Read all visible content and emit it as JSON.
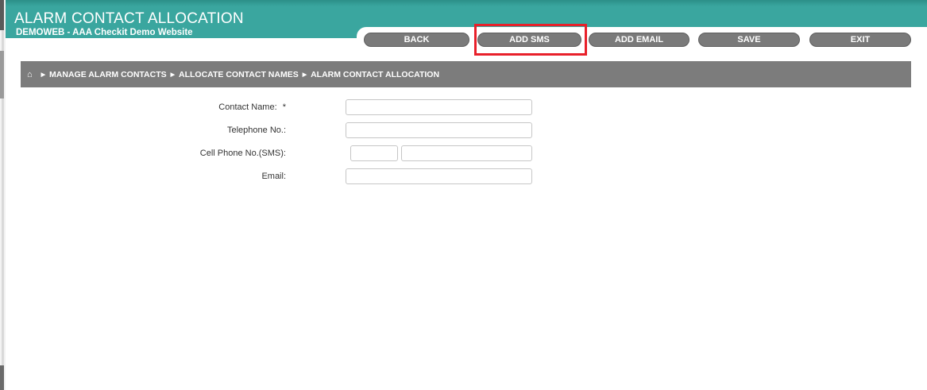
{
  "header": {
    "title": "ALARM CONTACT ALLOCATION",
    "subtitle": "DEMOWEB - AAA Checkit Demo Website"
  },
  "toolbar": {
    "back": "BACK",
    "add_sms": "ADD SMS",
    "add_email": "ADD EMAIL",
    "save": "SAVE",
    "exit": "EXIT"
  },
  "breadcrumb": {
    "home_icon": "home-icon",
    "items": [
      "MANAGE ALARM CONTACTS",
      "ALLOCATE CONTACT NAMES",
      "ALARM CONTACT ALLOCATION"
    ]
  },
  "form": {
    "contact_name_label": "Contact Name:",
    "required_mark": "*",
    "telephone_label": "Telephone No.:",
    "cell_label": "Cell Phone No.(SMS):",
    "email_label": "Email:",
    "contact_name_value": "",
    "telephone_value": "",
    "cell_prefix_value": "",
    "cell_number_value": "",
    "email_value": ""
  },
  "colors": {
    "header": "#3aa69f",
    "button": "#7a7a7a",
    "breadcrumb": "#7c7c7c",
    "highlight": "#e8202a"
  }
}
